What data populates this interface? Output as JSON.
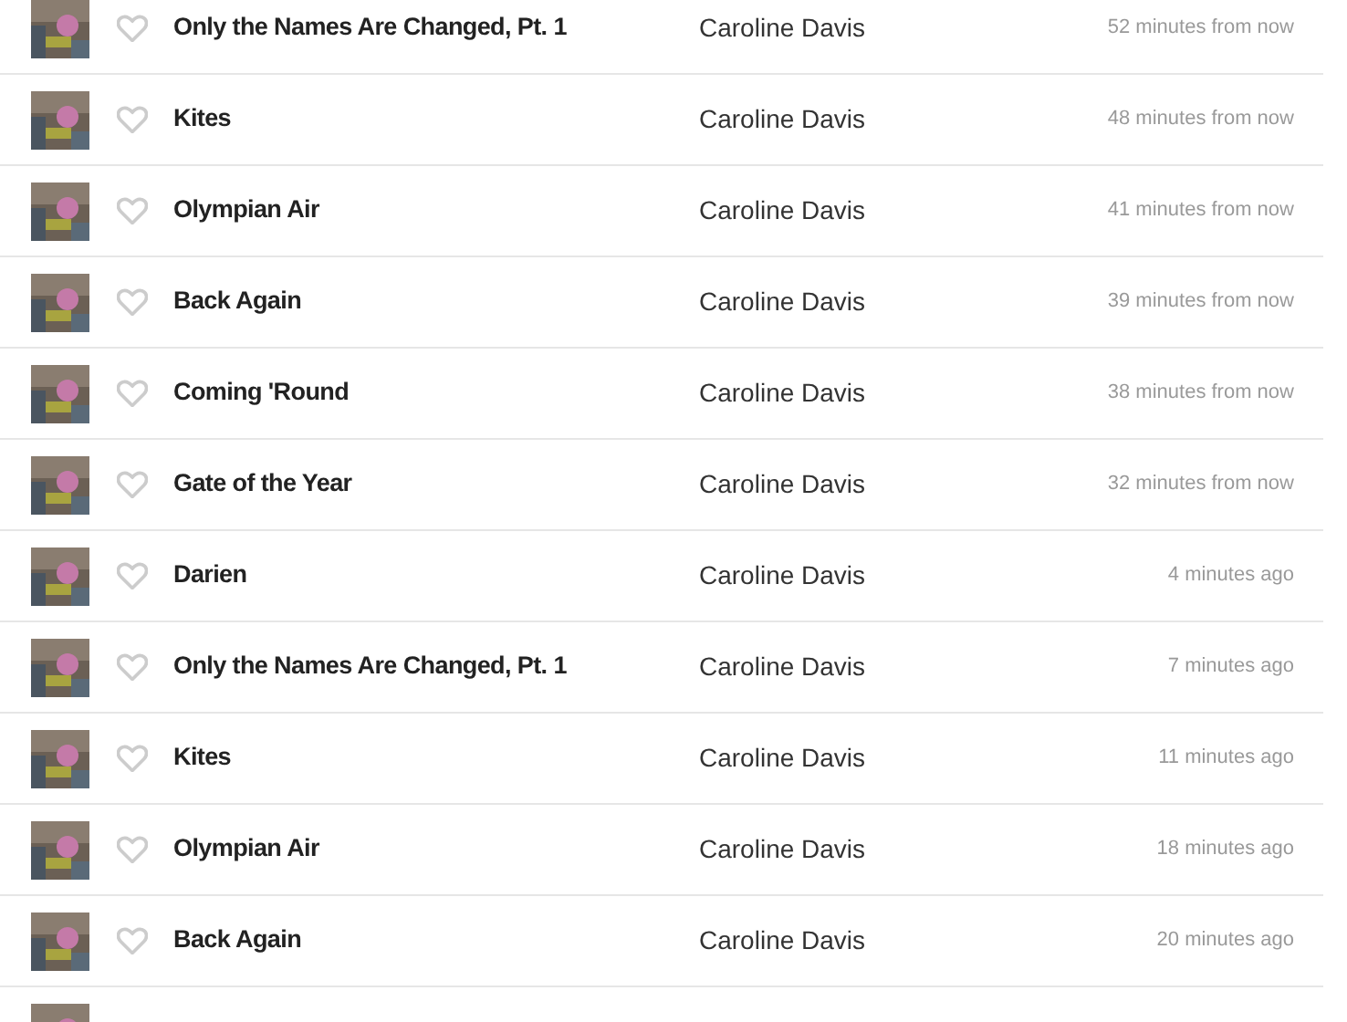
{
  "tracks": [
    {
      "title": "Only the Names Are Changed, Pt. 1",
      "artist": "Caroline Davis",
      "time": "52 minutes from now",
      "liked": false
    },
    {
      "title": "Kites",
      "artist": "Caroline Davis",
      "time": "48 minutes from now",
      "liked": false
    },
    {
      "title": "Olympian Air",
      "artist": "Caroline Davis",
      "time": "41 minutes from now",
      "liked": false
    },
    {
      "title": "Back Again",
      "artist": "Caroline Davis",
      "time": "39 minutes from now",
      "liked": false
    },
    {
      "title": "Coming 'Round",
      "artist": "Caroline Davis",
      "time": "38 minutes from now",
      "liked": false
    },
    {
      "title": "Gate of the Year",
      "artist": "Caroline Davis",
      "time": "32 minutes from now",
      "liked": false
    },
    {
      "title": "Darien",
      "artist": "Caroline Davis",
      "time": "4 minutes ago",
      "liked": false
    },
    {
      "title": "Only the Names Are Changed, Pt. 1",
      "artist": "Caroline Davis",
      "time": "7 minutes ago",
      "liked": false
    },
    {
      "title": "Kites",
      "artist": "Caroline Davis",
      "time": "11 minutes ago",
      "liked": false
    },
    {
      "title": "Olympian Air",
      "artist": "Caroline Davis",
      "time": "18 minutes ago",
      "liked": false
    },
    {
      "title": "Back Again",
      "artist": "Caroline Davis",
      "time": "20 minutes ago",
      "liked": false
    }
  ]
}
